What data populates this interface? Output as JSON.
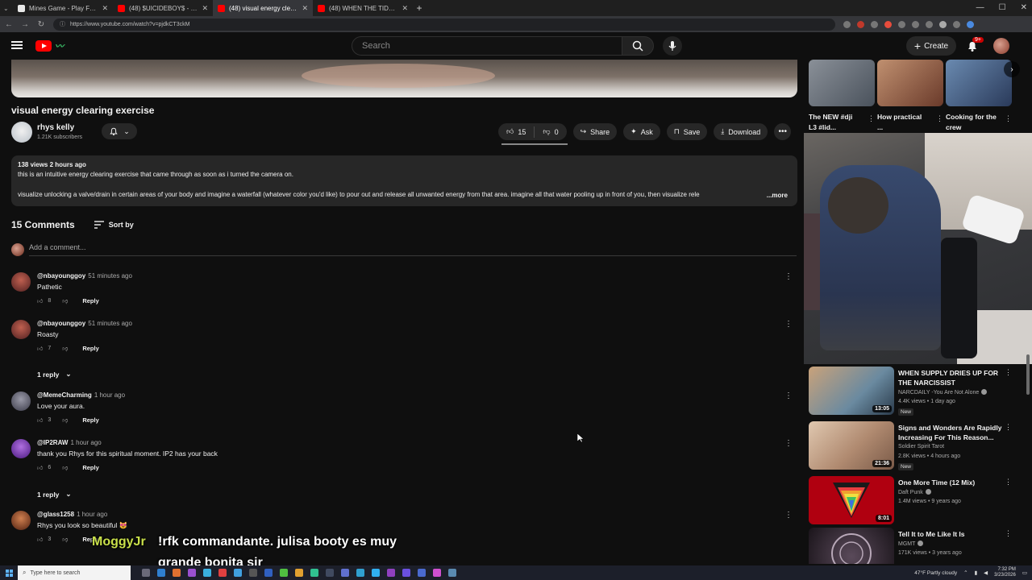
{
  "browser": {
    "tabs": [
      {
        "label": "Mines Game - Play Free Social Ca",
        "color": "#e8e8e8",
        "active": false
      },
      {
        "label": "(48) $UICIDEBOY$ - MATTE BLACK",
        "color": "#ff0000",
        "active": false
      },
      {
        "label": "(48) visual energy clearing ex",
        "color": "#ff0000",
        "active": true
      },
      {
        "label": "(48) WHEN THE TIDES TURN AGA",
        "color": "#ff0000",
        "active": false
      }
    ],
    "new_tab": "+",
    "url": "https://www.youtube.com/watch?v=pjdkCT3ckM"
  },
  "header": {
    "search_placeholder": "Search",
    "create_label": "Create",
    "notification_badge": "9+"
  },
  "video": {
    "title": "visual energy clearing exercise",
    "channel_name": "rhys kelly",
    "subscribers": "1.21K subscribers",
    "likes": "15",
    "dislikes": "0",
    "share_label": "Share",
    "ask_label": "Ask",
    "save_label": "Save",
    "download_label": "Download"
  },
  "description": {
    "meta": "138 views  2 hours ago",
    "line1": "this is an intuitive energy clearing exercise that came through as soon as i turned the camera on.",
    "line2": "visualize unlocking a valve/drain in certain areas of your body and imagine a waterfall (whatever color you'd like) to pour out and release all unwanted energy from that area. imagine all that water pooling up in front of you, then visualize rele",
    "more": "...more"
  },
  "comments": {
    "count_label": "15 Comments",
    "sort_label": "Sort by",
    "add_placeholder": "Add a comment...",
    "reply_label": "Reply",
    "items": [
      {
        "author": "@nbayounggoy",
        "time": "51 minutes ago",
        "text": "Pathetic",
        "likes": "8",
        "avatar": "#7a3030"
      },
      {
        "author": "@nbayounggoy",
        "time": "51 minutes ago",
        "text": "Roasty",
        "likes": "7",
        "avatar": "#7a3030"
      },
      {
        "author": "@MemeCharming",
        "time": "1 hour ago",
        "text": "Love your aura.",
        "likes": "3",
        "avatar": "#5a5a6a"
      },
      {
        "author": "@IP2RAW",
        "time": "1 hour ago",
        "text": "thank you Rhys for this spiritual moment. IP2 has your back",
        "likes": "6",
        "avatar": "#6a3aa0"
      },
      {
        "author": "@glass1258",
        "time": "1 hour ago",
        "text": "Rhys you look so beautiful 😻",
        "likes": "3",
        "avatar": "#8a3a2a"
      }
    ],
    "replies_1": "1 reply",
    "replies_2": "1 reply"
  },
  "shelf": [
    {
      "title": "The NEW #dji L3 #lid...",
      "thumb": "#6a7480"
    },
    {
      "title": "How practical ...",
      "thumb": "#8a5a4a"
    },
    {
      "title": "Cooking for the crew",
      "thumb": "#4a6a8a"
    }
  ],
  "recommendations": [
    {
      "title": "WHEN SUPPLY DRIES UP FOR THE NARCISSIST",
      "channel": "NARCDAILY -You Are Not Alone",
      "views": "4.4K views • 1 day ago",
      "duration": "13:05",
      "badge": "New",
      "thumb": "#5a7a90",
      "verified": true
    },
    {
      "title": "Signs and Wonders Are Rapidly Increasing For This Reason...",
      "channel": "Soldier Spirit Tarot",
      "views": "2.8K views • 4 hours ago",
      "duration": "21:36",
      "badge": "New",
      "thumb": "#c9a890",
      "verified": false
    },
    {
      "title": "One More Time (12 Mix)",
      "channel": "Daft Punk",
      "views": "1.4M views • 9 years ago",
      "duration": "8:01",
      "badge": "",
      "thumb": "#b00010",
      "verified": true
    },
    {
      "title": "Tell It to Me Like It Is",
      "channel": "MGMT",
      "views": "171K views • 3 years ago",
      "duration": "",
      "badge": "",
      "thumb": "#3a2a3a",
      "verified": true
    }
  ],
  "overlay": {
    "user": "MoggyJr",
    "message": "!rfk commandante. julisa booty es muy grande bonita sir"
  },
  "taskbar": {
    "search_placeholder": "Type here to search",
    "weather": "47°F  Partly cloudy",
    "time": "7:32 PM",
    "date": "3/23/2026"
  }
}
